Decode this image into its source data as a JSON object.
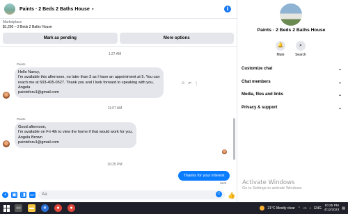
{
  "header": {
    "title": "Paints · 2 Beds 2 Baths House"
  },
  "listing": {
    "source": "Marketplace",
    "price_title": "$1,250 – 2 Beds 2 Baths House",
    "mark_pending_label": "Mark as pending",
    "more_options_label": "More options"
  },
  "messages": [
    {
      "timestamp": "1:27 AM",
      "sender": "Paints",
      "lines": [
        "Hello Nancy,",
        "I'm available this afternoon, no later than 3 as I have an appointment at 5. You can",
        "reach me at 503-405-0527. Thank you and I look forward to speaking with you,",
        "Angela",
        "paintsforu1@gmail.com"
      ]
    },
    {
      "timestamp": "11:07 AM",
      "sender": "Paints",
      "lines": [
        "Good afternoon,",
        "I'm available on Fri 4th to view the home if that would work for you.",
        "Angela Brown",
        "paintsforu1@gmail.com"
      ]
    }
  ],
  "outgoing": {
    "timestamp": "10:25 PM",
    "text": "Thanks for your interest",
    "status": "Sent"
  },
  "composer": {
    "placeholder": "Aa"
  },
  "info_panel": {
    "name": "Paints · 2 Beds 2 Baths House",
    "actions": [
      {
        "label": "Mute",
        "icon": "bell-icon"
      },
      {
        "label": "Search",
        "icon": "search-icon"
      }
    ],
    "sections": [
      "Customize chat",
      "Chat members",
      "Media, files and links",
      "Privacy & support"
    ]
  },
  "watermark": {
    "title": "Activate Windows",
    "subtitle": "Go to Settings to activate Windows."
  },
  "taskbar": {
    "weather": "21°C  Mostly clear",
    "language": "ENG",
    "time": "10:25 PM",
    "date": "4/12/2023"
  },
  "colors": {
    "accent": "#0a7cff",
    "bubble_gray": "#e4e6eb",
    "taskbar": "#20202a"
  }
}
